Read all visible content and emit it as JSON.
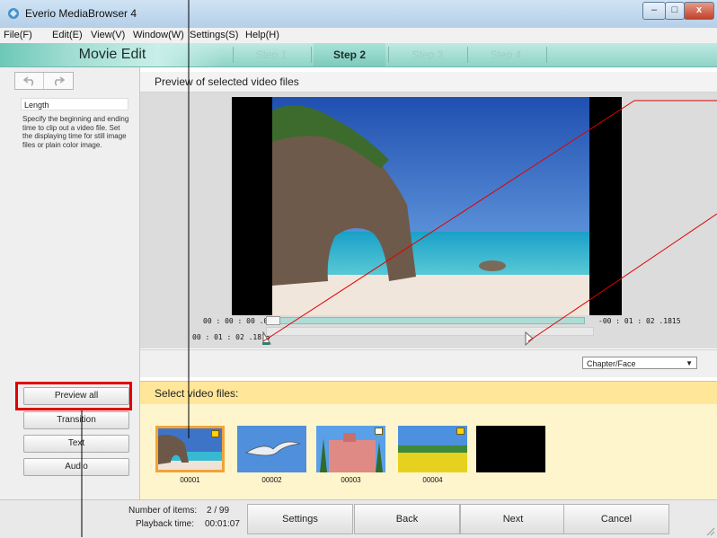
{
  "window": {
    "title": "Everio MediaBrowser 4",
    "minimize": "–",
    "maximize": "□",
    "close": "x"
  },
  "menu": [
    "File(F)",
    "Edit(E)",
    "View(V)",
    "Window(W)",
    "Settings(S)",
    "Help(H)"
  ],
  "stepbar": {
    "mode": "Movie Edit",
    "steps": [
      {
        "label": "Step 1",
        "active": false
      },
      {
        "label": "Step 2",
        "active": true
      },
      {
        "label": "Step 3",
        "active": false
      },
      {
        "label": "Step 4",
        "active": false
      }
    ]
  },
  "left": {
    "undo_icon": "undo-icon",
    "redo_icon": "redo-icon",
    "help_title": "Length",
    "help_text": "Specify the beginning and ending time to clip out a video file. Set the displaying time for still image files or plain color image.",
    "buttons": {
      "preview_all": "Preview all",
      "transition": "Transition",
      "text": "Text",
      "audio": "Audio"
    }
  },
  "preview": {
    "title": "Preview of selected video files",
    "time_current": "00 : 00 : 00 .00",
    "time_remaining": "-00 : 01 : 02 .1815",
    "time_length": "00 : 01 : 02 .1815",
    "chapter_select": "Chapter/Face"
  },
  "select": {
    "title": "Select video files:",
    "thumbnails": [
      {
        "label": "00001",
        "selected": true
      },
      {
        "label": "00002",
        "selected": false
      },
      {
        "label": "00003",
        "selected": false
      },
      {
        "label": "00004",
        "selected": false
      },
      {
        "label": "",
        "selected": false
      }
    ]
  },
  "footer": {
    "items_label": "Number of items:",
    "items_value": "2 / 99",
    "playback_label": "Playback time:",
    "playback_value": "00:01:07",
    "buttons": {
      "settings": "Settings",
      "back": "Back",
      "next": "Next",
      "cancel": "Cancel"
    }
  },
  "colors": {
    "accent_teal": "#8ed3c7",
    "highlight_red": "#e00000",
    "select_yellow": "#ffe699"
  }
}
